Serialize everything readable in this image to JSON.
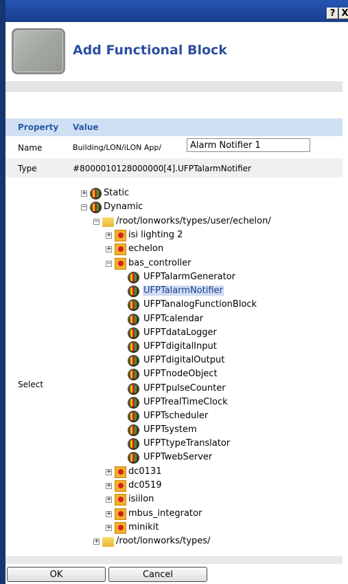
{
  "window": {
    "help_label": "?",
    "close_label": "X"
  },
  "dialog": {
    "title": "Add Functional Block"
  },
  "table": {
    "headers": {
      "property": "Property",
      "value": "Value"
    },
    "name": {
      "label": "Name",
      "prefix": "Building/LON/iLON App/",
      "input_value": "Alarm Notifier 1"
    },
    "type": {
      "label": "Type",
      "value": "#8000010128000000[4].UFPTalarmNotifier"
    },
    "select": {
      "label": "Select"
    }
  },
  "tree": [
    {
      "label": "Static",
      "toggle": "+",
      "icon": "function-block-icon"
    },
    {
      "label": "Dynamic",
      "toggle": "−",
      "icon": "function-block-icon"
    },
    {
      "label": "/root/lonworks/types/user/echelon/",
      "toggle": "−",
      "icon": "folder-icon"
    },
    {
      "label": "isi lighting 2",
      "toggle": "+",
      "icon": "functional-type-icon"
    },
    {
      "label": "echelon",
      "toggle": "+",
      "icon": "functional-type-icon"
    },
    {
      "label": "bas_controller",
      "toggle": "−",
      "icon": "functional-type-icon"
    },
    {
      "label": "UFPTalarmGenerator",
      "icon": "function-block-icon"
    },
    {
      "label": "UFPTalarmNotifier",
      "icon": "function-block-icon",
      "selected": true
    },
    {
      "label": "UFPTanalogFunctionBlock",
      "icon": "function-block-icon"
    },
    {
      "label": "UFPTcalendar",
      "icon": "function-block-icon"
    },
    {
      "label": "UFPTdataLogger",
      "icon": "function-block-icon"
    },
    {
      "label": "UFPTdigitalInput",
      "icon": "function-block-icon"
    },
    {
      "label": "UFPTdigitalOutput",
      "icon": "function-block-icon"
    },
    {
      "label": "UFPTnodeObject",
      "icon": "function-block-icon"
    },
    {
      "label": "UFPTpulseCounter",
      "icon": "function-block-icon"
    },
    {
      "label": "UFPTrealTimeClock",
      "icon": "function-block-icon"
    },
    {
      "label": "UFPTscheduler",
      "icon": "function-block-icon"
    },
    {
      "label": "UFPTsystem",
      "icon": "function-block-icon"
    },
    {
      "label": "UFPTtypeTranslator",
      "icon": "function-block-icon"
    },
    {
      "label": "UFPTwebServer",
      "icon": "function-block-icon"
    },
    {
      "label": "dc0131",
      "toggle": "+",
      "icon": "functional-type-icon"
    },
    {
      "label": "dc0519",
      "toggle": "+",
      "icon": "functional-type-icon"
    },
    {
      "label": "isiilon",
      "toggle": "+",
      "icon": "functional-type-icon"
    },
    {
      "label": "mbus_integrator",
      "toggle": "+",
      "icon": "functional-type-icon"
    },
    {
      "label": "minikit",
      "toggle": "+",
      "icon": "functional-type-icon"
    },
    {
      "label": "/root/lonworks/types/",
      "toggle": "+",
      "icon": "folder-icon"
    }
  ],
  "buttons": {
    "ok": "OK",
    "cancel": "Cancel"
  },
  "colors": {
    "title": "#2c4fa0",
    "header_bg": "#cfe0f5",
    "selection": "#cfdcf2",
    "window_frame": "#1a3d8a"
  }
}
